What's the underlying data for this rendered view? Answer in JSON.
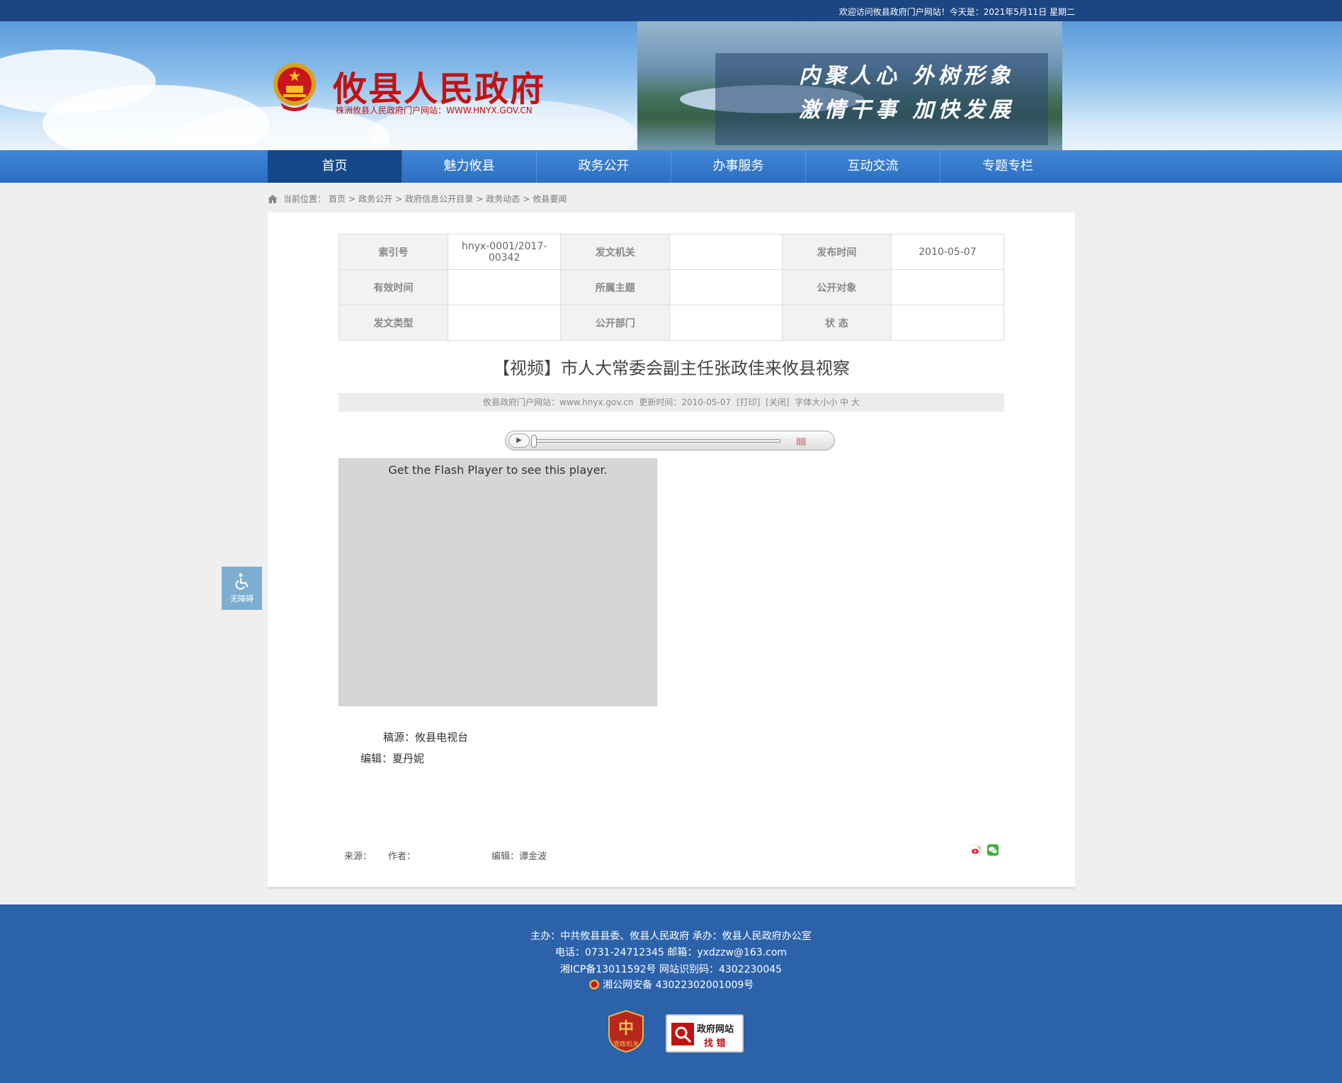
{
  "topbar": {
    "welcome": "欢迎访问攸县政府门户网站！今天是：2021年5月11日 星期二"
  },
  "header": {
    "title": "攸县人民政府",
    "subtitle": "株洲攸县人民政府门户网站：WWW.HNYX.GOV.CN",
    "slogan_1": "内聚人心 外树形象",
    "slogan_2": "激情干事 加快发展"
  },
  "nav": {
    "items": [
      "首页",
      "魅力攸县",
      "政务公开",
      "办事服务",
      "互动交流",
      "专题专栏"
    ],
    "active": "首页"
  },
  "breadcrumb": {
    "prefix": "当前位置：",
    "items": [
      "首页",
      "政务公开",
      "政府信息公开目录",
      "政务动态",
      "攸县要闻"
    ],
    "separator": ">"
  },
  "meta": {
    "rows": [
      [
        {
          "label": "索引号",
          "value": "hnyx-0001/2017-00342"
        },
        {
          "label": "发文机关",
          "value": ""
        },
        {
          "label": "发布时间",
          "value": "2010-05-07"
        }
      ],
      [
        {
          "label": "有效时间",
          "value": ""
        },
        {
          "label": "所属主题",
          "value": ""
        },
        {
          "label": "公开对象",
          "value": ""
        }
      ],
      [
        {
          "label": "发文类型",
          "value": ""
        },
        {
          "label": "公开部门",
          "value": ""
        },
        {
          "label": "状 态",
          "value": ""
        }
      ]
    ]
  },
  "article": {
    "title": "【视频】市人大常委会副主任张政佳来攸县视察",
    "info": {
      "site": "攸县政府门户网站：www.hnyx.gov.cn",
      "updated": "更新时间：2010-05-07",
      "print": "[打印]",
      "close": "[关闭]",
      "font_size": "字体大小小 中 大"
    },
    "flash_notice": "Get the Flash Player to see this player.",
    "source_line": "稿源：攸县电视台",
    "editor_line": "编辑：夏丹妮"
  },
  "footer_meta": {
    "source": "来源：",
    "author": "作者：",
    "editor": "编辑：谭金波"
  },
  "a11y": {
    "label": "无障碍"
  },
  "footer": {
    "line1": "主办：中共攸县县委、攸县人民政府  承办：攸县人民政府办公室",
    "line2": "电话：0731-24712345  邮箱：yxdzzw@163.com",
    "line3": "湘ICP备13011592号    网站识别码：4302230045",
    "line4": "湘公网安备 43022302001009号",
    "badge_party": "党政机关",
    "badge_error_1": "政府网站",
    "badge_error_2": "找 错"
  },
  "colors": {
    "nav_bg": "#2d6fc1",
    "nav_active": "#154889",
    "title_red": "#c21212",
    "footer_bg": "#2b62aa",
    "topbar_bg": "#1b4583"
  }
}
